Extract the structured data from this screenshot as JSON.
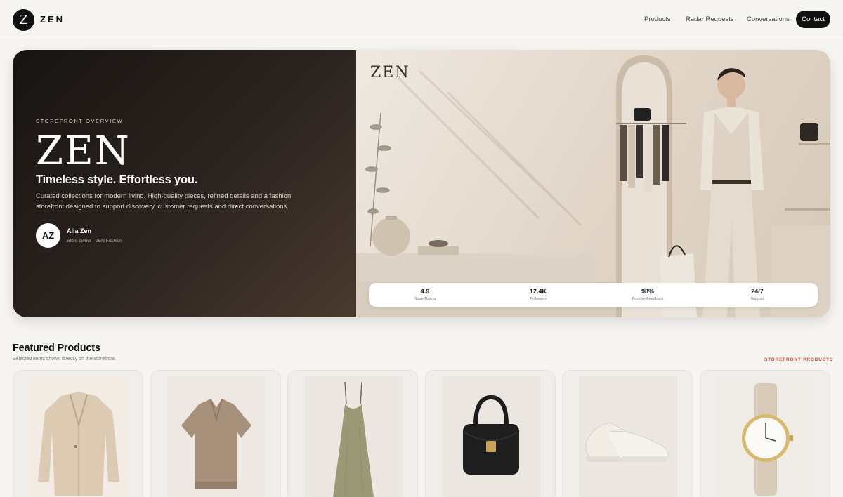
{
  "brand": {
    "mark": "Z",
    "name": "ZEN"
  },
  "nav": {
    "links": [
      "Products",
      "Radar Requests",
      "Conversations"
    ],
    "contact": "Contact"
  },
  "hero": {
    "eyebrow": "STOREFRONT OVERVIEW",
    "title": "ZEN",
    "subtitle": "Timeless style. Effortless you.",
    "description": "Curated collections for modern living. High-quality pieces, refined details and a fashion storefront designed to support discovery, customer requests and direct conversations.",
    "owner": {
      "initials": "AZ",
      "name": "Alia Zen",
      "role": "Store owner · ZEN Fashion"
    },
    "image_watermark": "ZEN",
    "stats": [
      {
        "value": "4.9",
        "label": "Store Rating"
      },
      {
        "value": "12.4K",
        "label": "Followers"
      },
      {
        "value": "98%",
        "label": "Positive Feedback"
      },
      {
        "value": "24/7",
        "label": "Support"
      }
    ]
  },
  "featured": {
    "title": "Featured Products",
    "subtitle": "Selected items shown directly on the storefront.",
    "link": "STOREFRONT PRODUCTS",
    "products": [
      {
        "icon": "blazer-icon"
      },
      {
        "icon": "polo-shirt-icon"
      },
      {
        "icon": "slip-dress-icon"
      },
      {
        "icon": "handbag-icon"
      },
      {
        "icon": "sneakers-icon"
      },
      {
        "icon": "watch-icon"
      }
    ]
  },
  "colors": {
    "dark": "#111111",
    "accent": "#c1453f",
    "background": "#f7f5f2"
  }
}
